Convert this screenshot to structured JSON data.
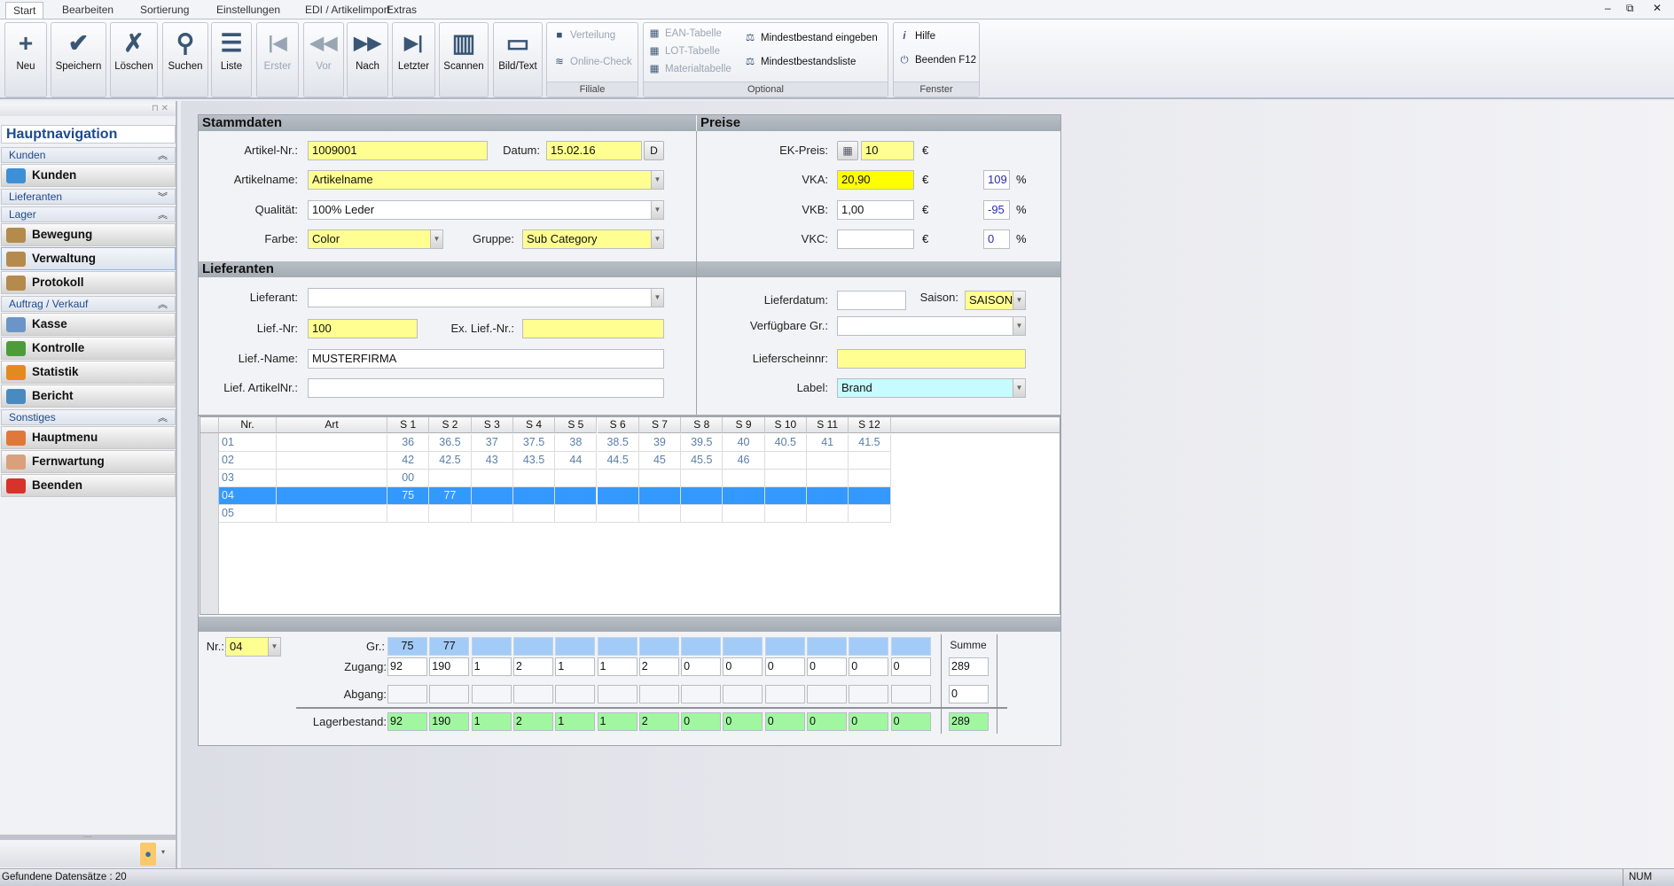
{
  "window": {
    "minimize": "–",
    "restore": "⧉",
    "close": "✕"
  },
  "tabs": [
    "Start",
    "Bearbeiten",
    "Sortierung",
    "Einstellungen",
    "EDI / Artikelimport",
    "Extras"
  ],
  "ribbon": {
    "buttons": [
      {
        "label": "Neu",
        "icon": "new-document-icon",
        "glyph": "+",
        "disabled": false
      },
      {
        "label": "Speichern",
        "icon": "checkmark-icon",
        "glyph": "✔",
        "disabled": false
      },
      {
        "label": "Löschen",
        "icon": "delete-document-icon",
        "glyph": "✗",
        "disabled": false
      },
      {
        "label": "Suchen",
        "icon": "magnifier-icon",
        "glyph": "⚲",
        "disabled": false
      },
      {
        "label": "Liste",
        "icon": "list-icon",
        "glyph": "☰",
        "disabled": false
      },
      {
        "label": "Erster",
        "icon": "first-record-icon",
        "glyph": "|◀",
        "disabled": true
      },
      {
        "label": "Vor",
        "icon": "previous-record-icon",
        "glyph": "◀◀",
        "disabled": true
      },
      {
        "label": "Nach",
        "icon": "next-record-icon",
        "glyph": "▶▶",
        "disabled": false
      },
      {
        "label": "Letzter",
        "icon": "last-record-icon",
        "glyph": "▶|",
        "disabled": false
      },
      {
        "label": "Scannen",
        "icon": "barcode-icon",
        "glyph": "▥",
        "disabled": false
      },
      {
        "label": "Bild/Text",
        "icon": "monitor-icon",
        "glyph": "▭",
        "disabled": false
      }
    ],
    "groups": {
      "filiale": {
        "title": "Filiale",
        "items": [
          {
            "label": "Verteilung",
            "icon": "distribution-icon",
            "glyph": "■"
          },
          {
            "label": "Online-Check",
            "icon": "wifi-icon",
            "glyph": "≋"
          }
        ]
      },
      "optional": {
        "title": "Optional",
        "items": [
          {
            "label": "EAN-Tabelle",
            "icon": "table-icon",
            "glyph": "▦"
          },
          {
            "label": "LOT-Tabelle",
            "icon": "table-icon",
            "glyph": "▦"
          },
          {
            "label": "Materialtabelle",
            "icon": "table-icon",
            "glyph": "▦"
          },
          {
            "label": "Mindestbestand eingeben",
            "icon": "scales-icon",
            "glyph": "⚖"
          },
          {
            "label": "Mindestbestandsliste",
            "icon": "scales-icon",
            "glyph": "⚖"
          }
        ]
      },
      "fenster": {
        "title": "Fenster",
        "items": [
          {
            "label": "Hilfe",
            "icon": "info-icon",
            "glyph": "i"
          },
          {
            "label": "Beenden F12",
            "icon": "power-icon",
            "glyph": "⏻"
          }
        ]
      }
    }
  },
  "sidebar": {
    "title": "Hauptnavigation",
    "pin": "⊓ ✕",
    "grip": ".....",
    "sections": [
      {
        "label": "Kunden",
        "expanded": true,
        "items": [
          {
            "label": "Kunden",
            "color": "#3d8fd6"
          }
        ]
      },
      {
        "label": "Lieferanten",
        "expanded": false,
        "items": []
      },
      {
        "label": "Lager",
        "expanded": true,
        "items": [
          {
            "label": "Bewegung",
            "color": "#b58a4d"
          },
          {
            "label": "Verwaltung",
            "color": "#b58a4d",
            "selected": true
          },
          {
            "label": "Protokoll",
            "color": "#b58a4d"
          }
        ]
      },
      {
        "label": "Auftrag / Verkauf",
        "expanded": true,
        "items": [
          {
            "label": "Kasse",
            "color": "#6b95c9"
          },
          {
            "label": "Kontrolle",
            "color": "#4d9c3a"
          },
          {
            "label": "Statistik",
            "color": "#e38a1e"
          },
          {
            "label": "Bericht",
            "color": "#4a8bbf"
          }
        ]
      },
      {
        "label": "Sonstiges",
        "expanded": true,
        "items": [
          {
            "label": "Hauptmenu",
            "color": "#e0783a"
          },
          {
            "label": "Fernwartung",
            "color": "#d9a07a"
          },
          {
            "label": "Beenden",
            "color": "#d8322a"
          }
        ]
      }
    ]
  },
  "stammdaten": {
    "title": "Stammdaten",
    "artikel_nr": {
      "label": "Artikel-Nr.:",
      "value": "1009001"
    },
    "datum": {
      "label": "Datum:",
      "value": "15.02.16",
      "button": "D"
    },
    "artikelname": {
      "label": "Artikelname:",
      "value": "Artikelname"
    },
    "qualitaet": {
      "label": "Qualität:",
      "value": "100% Leder"
    },
    "farbe": {
      "label": "Farbe:",
      "value": "Color"
    },
    "gruppe": {
      "label": "Gruppe:",
      "value": "Sub Category"
    }
  },
  "preise": {
    "title": "Preise",
    "currency": "€",
    "percent": "%",
    "ek": {
      "label": "EK-Preis:",
      "value": "10"
    },
    "vka": {
      "label": "VKA:",
      "value": "20,90",
      "pct": "109"
    },
    "vkb": {
      "label": "VKB:",
      "value": "1,00",
      "pct": "-95"
    },
    "vkc": {
      "label": "VKC:",
      "value": "",
      "pct": "0"
    }
  },
  "lieferanten": {
    "title": "Lieferanten",
    "lieferant": {
      "label": "Lieferant:",
      "value": ""
    },
    "lief_nr": {
      "label": "Lief.-Nr:",
      "value": "100"
    },
    "ex_lief_nr": {
      "label": "Ex. Lief.-Nr.:",
      "value": ""
    },
    "lief_name": {
      "label": "Lief.-Name:",
      "value": "MUSTERFIRMA"
    },
    "lief_artikelnr": {
      "label": "Lief. ArtikelNr.:",
      "value": ""
    },
    "lieferdatum": {
      "label": "Lieferdatum:",
      "value": ""
    },
    "saison": {
      "label": "Saison:",
      "value": "SAISON"
    },
    "verfuegbare": {
      "label": "Verfügbare Gr.:",
      "value": ""
    },
    "lieferscheinnr": {
      "label": "Lieferscheinnr:",
      "value": ""
    },
    "label": {
      "label": "Label:",
      "value": "Brand"
    }
  },
  "grid": {
    "columns": [
      "Nr.",
      "Art",
      "S 1",
      "S 2",
      "S 3",
      "S 4",
      "S 5",
      "S 6",
      "S 7",
      "S 8",
      "S 9",
      "S 10",
      "S 11",
      "S 12"
    ],
    "rows": [
      {
        "nr": "01",
        "art": "",
        "sizes": [
          "36",
          "36.5",
          "37",
          "37.5",
          "38",
          "38.5",
          "39",
          "39.5",
          "40",
          "40.5",
          "41",
          "41.5"
        ]
      },
      {
        "nr": "02",
        "art": "",
        "sizes": [
          "42",
          "42.5",
          "43",
          "43.5",
          "44",
          "44.5",
          "45",
          "45.5",
          "46",
          "",
          "",
          ""
        ]
      },
      {
        "nr": "03",
        "art": "",
        "sizes": [
          "00",
          "",
          "",
          "",
          "",
          "",
          "",
          "",
          "",
          "",
          "",
          ""
        ]
      },
      {
        "nr": "04",
        "art": "",
        "sizes": [
          "75",
          "77",
          "",
          "",
          "",
          "",
          "",
          "",
          "",
          "",
          "",
          ""
        ],
        "selected": true
      },
      {
        "nr": "05",
        "art": "",
        "sizes": [
          "",
          "",
          "",
          "",
          "",
          "",
          "",
          "",
          "",
          "",
          "",
          ""
        ]
      }
    ]
  },
  "bestand": {
    "nr_label": "Nr.:",
    "nr_value": "04",
    "gr_label": "Gr.:",
    "zugang_label": "Zugang:",
    "abgang_label": "Abgang:",
    "lager_label": "Lagerbestand:",
    "summe_label": "Summe",
    "gr": [
      "75",
      "77",
      "",
      "",
      "",
      "",
      "",
      "",
      "",
      "",
      "",
      "",
      ""
    ],
    "zugang": [
      "92",
      "190",
      "1",
      "2",
      "1",
      "1",
      "2",
      "0",
      "0",
      "0",
      "0",
      "0",
      "0"
    ],
    "abgang": [
      "",
      "",
      "",
      "",
      "",
      "",
      "",
      "",
      "",
      "",
      "",
      "",
      ""
    ],
    "lager": [
      "92",
      "190",
      "1",
      "2",
      "1",
      "1",
      "2",
      "0",
      "0",
      "0",
      "0",
      "0",
      "0"
    ],
    "summe": {
      "zugang": "289",
      "abgang": "0",
      "lager": "289"
    }
  },
  "status": {
    "text": "Gefundene Datensätze : 20",
    "num": "NUM"
  }
}
